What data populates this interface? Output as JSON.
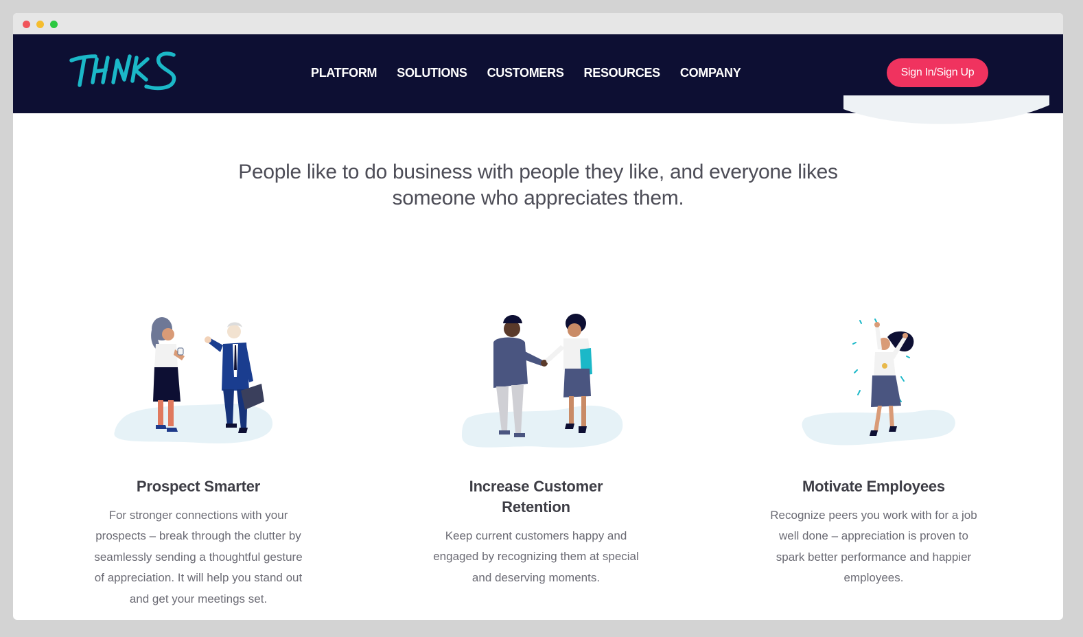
{
  "window": {
    "controls": [
      "close",
      "minimize",
      "maximize"
    ]
  },
  "brand": {
    "logo_text": "THNKS",
    "logo_color": "#1bb8c8",
    "nav_bg": "#0d0f33",
    "accent": "#f0335f"
  },
  "nav": {
    "items": [
      {
        "label": "PLATFORM"
      },
      {
        "label": "SOLUTIONS"
      },
      {
        "label": "CUSTOMERS"
      },
      {
        "label": "RESOURCES"
      },
      {
        "label": "COMPANY"
      }
    ],
    "signin_label": "Sign In/Sign Up"
  },
  "hero": {
    "tagline_line1": "People like to do business with people they like, and everyone likes",
    "tagline_line2": "someone who appreciates them."
  },
  "features": [
    {
      "title": "Prospect Smarter",
      "description": "For stronger connections with your prospects – break through the clutter by seamlessly sending a thoughtful gesture of appreciation. It will help you stand out and get your meetings set.",
      "illustration": "two-business-people-meeting"
    },
    {
      "title": "Increase Customer Retention",
      "description": "Keep current customers happy and engaged by recognizing them at special and deserving moments.",
      "illustration": "handshake"
    },
    {
      "title": "Motivate Employees",
      "description": "Recognize peers you work with for a job well done – appreciation is proven to spark better performance and happier employees.",
      "illustration": "celebrating-employee"
    }
  ]
}
